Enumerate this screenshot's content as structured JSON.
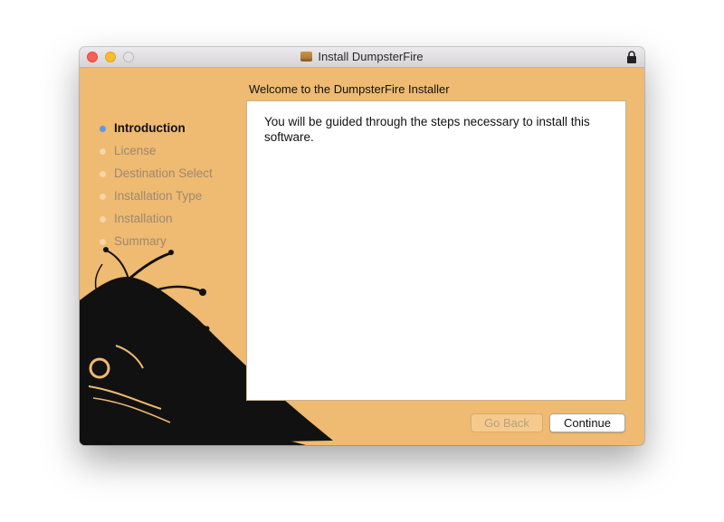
{
  "window": {
    "title": "Install DumpsterFire",
    "background_color": "#efba71"
  },
  "header": {
    "heading": "Welcome to the DumpsterFire Installer"
  },
  "sidebar": {
    "steps": [
      {
        "label": "Introduction",
        "active": true
      },
      {
        "label": "License",
        "active": false
      },
      {
        "label": "Destination Select",
        "active": false
      },
      {
        "label": "Installation Type",
        "active": false
      },
      {
        "label": "Installation",
        "active": false
      },
      {
        "label": "Summary",
        "active": false
      }
    ]
  },
  "main": {
    "body_text": "You will be guided through the steps necessary to install this software."
  },
  "buttons": {
    "back_label": "Go Back",
    "continue_label": "Continue"
  }
}
